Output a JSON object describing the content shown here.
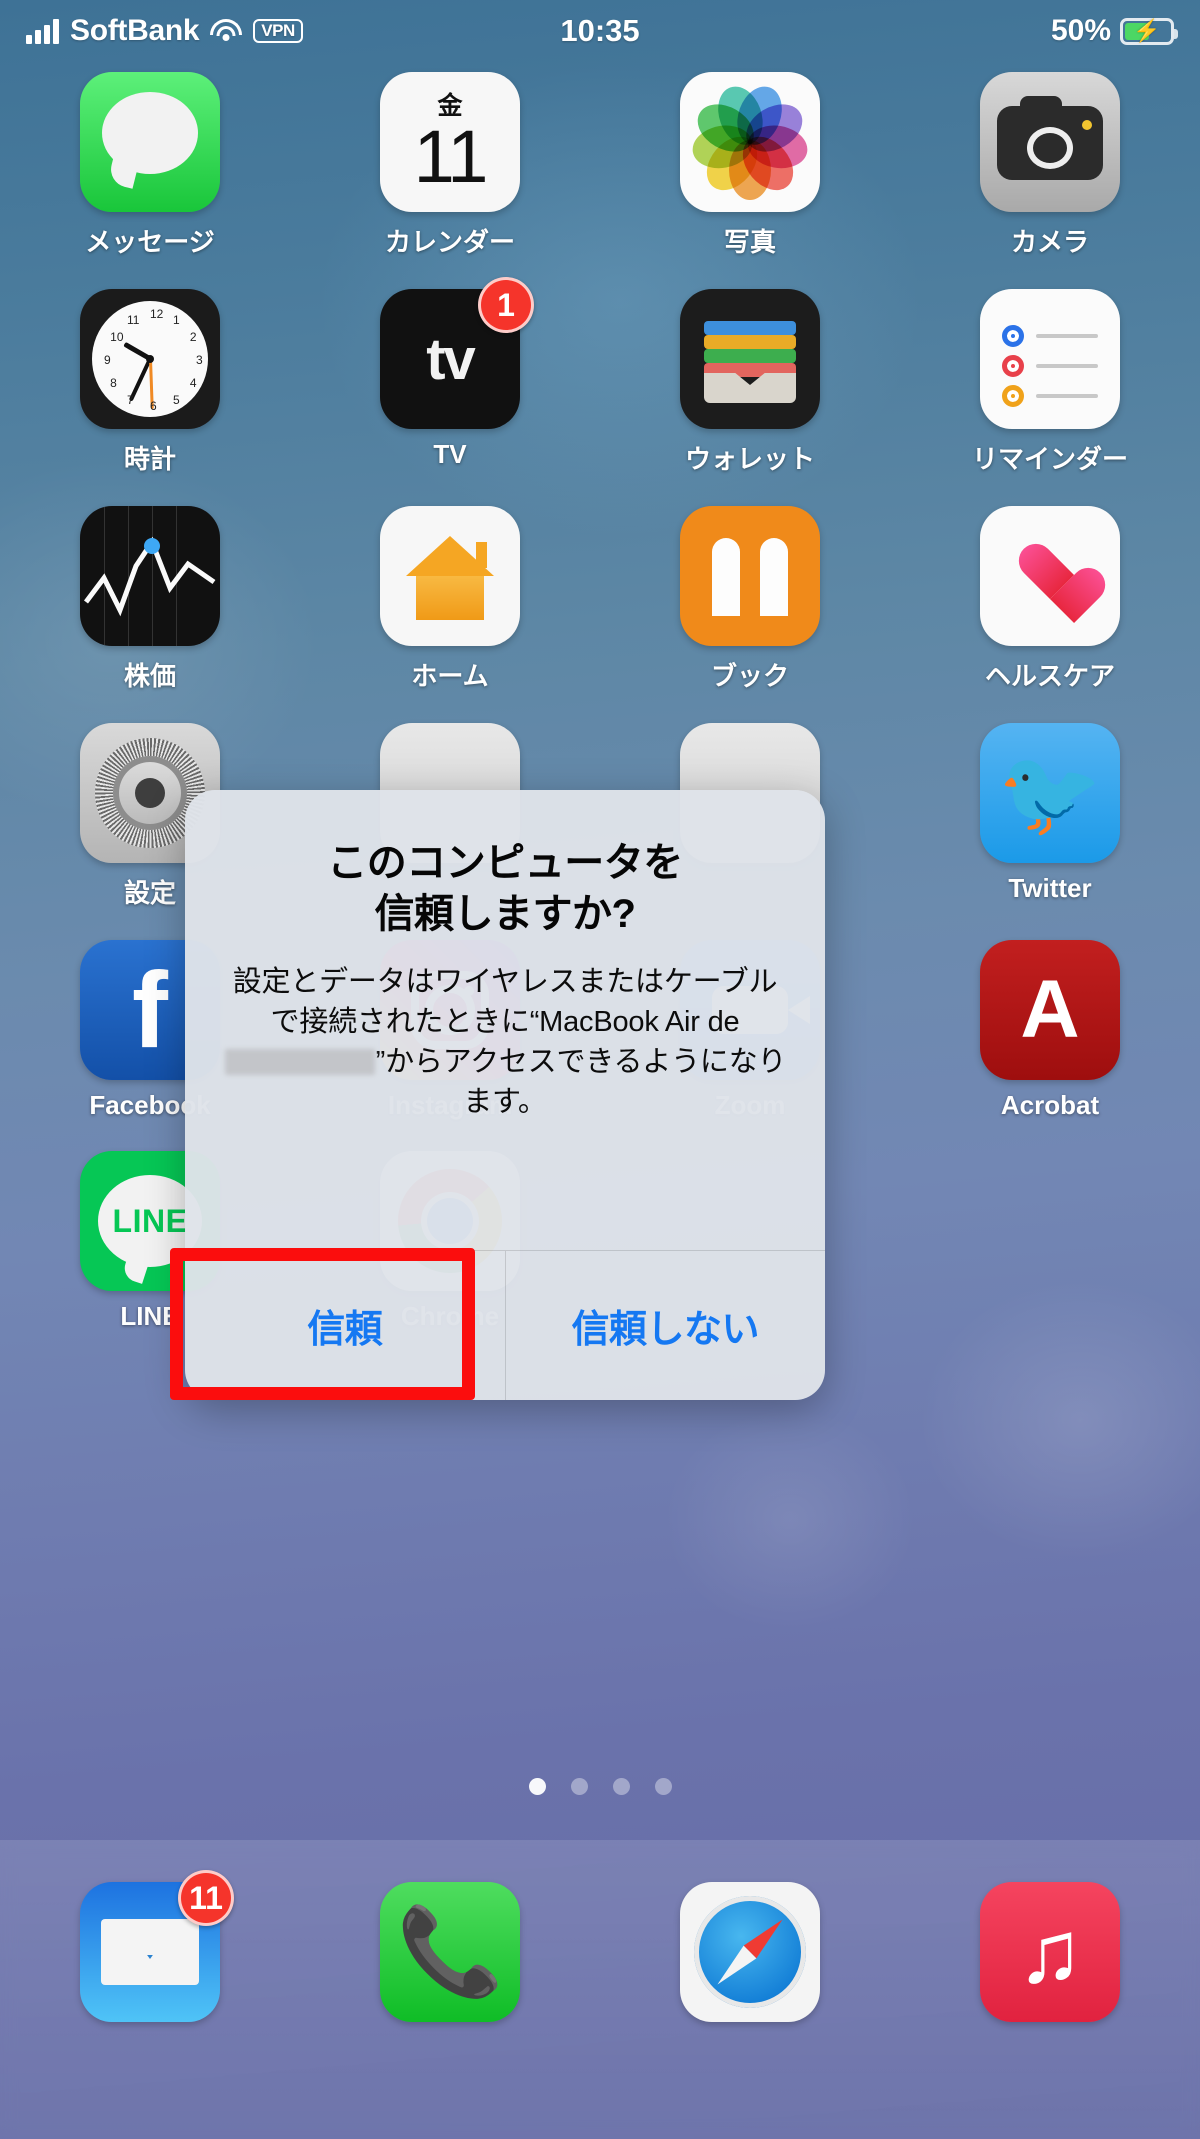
{
  "status_bar": {
    "carrier": "SoftBank",
    "signal_icon": "signal-bars-icon",
    "wifi_icon": "wifi-icon",
    "vpn_label": "VPN",
    "time": "10:35",
    "battery_percent": "50%",
    "battery_icon": "battery-charging-icon"
  },
  "home_screen": {
    "rows": [
      [
        {
          "label": "メッセージ",
          "icon": "messages-icon",
          "badge": null
        },
        {
          "label": "カレンダー",
          "icon": "calendar-icon",
          "badge": null,
          "day_of_week": "金",
          "day_number": "11"
        },
        {
          "label": "写真",
          "icon": "photos-icon",
          "badge": null
        },
        {
          "label": "カメラ",
          "icon": "camera-icon",
          "badge": null
        }
      ],
      [
        {
          "label": "時計",
          "icon": "clock-icon",
          "badge": null
        },
        {
          "label": "TV",
          "icon": "apple-tv-icon",
          "badge": "1"
        },
        {
          "label": "ウォレット",
          "icon": "wallet-icon",
          "badge": null
        },
        {
          "label": "リマインダー",
          "icon": "reminders-icon",
          "badge": null
        }
      ],
      [
        {
          "label": "株価",
          "icon": "stocks-icon",
          "badge": null
        },
        {
          "label": "ホーム",
          "icon": "home-app-icon",
          "badge": null
        },
        {
          "label": "ブック",
          "icon": "books-icon",
          "badge": null
        },
        {
          "label": "ヘルスケア",
          "icon": "health-icon",
          "badge": null
        }
      ],
      [
        {
          "label": "設定",
          "icon": "settings-gear-icon",
          "badge": null
        },
        {
          "label": "",
          "icon": "blank-icon",
          "badge": null
        },
        {
          "label": "",
          "icon": "blank-icon",
          "badge": null
        },
        {
          "label": "Twitter",
          "icon": "twitter-icon",
          "badge": null
        }
      ],
      [
        {
          "label": "Facebook",
          "icon": "facebook-icon",
          "badge": null
        },
        {
          "label": "Instagram",
          "icon": "instagram-icon",
          "badge": null
        },
        {
          "label": "Zoom",
          "icon": "zoom-icon",
          "badge": null
        },
        {
          "label": "Acrobat",
          "icon": "acrobat-icon",
          "badge": null
        }
      ],
      [
        {
          "label": "LINE",
          "icon": "line-icon",
          "badge": null,
          "mark": "LINE"
        },
        {
          "label": "Chrome",
          "icon": "chrome-icon",
          "badge": null
        },
        {
          "label": "",
          "icon": "blank-icon",
          "badge": null
        },
        {
          "label": "",
          "icon": "blank-icon",
          "badge": null
        }
      ]
    ],
    "page_dots": {
      "count": 4,
      "active_index": 0
    }
  },
  "dock": [
    {
      "label": "",
      "icon": "mail-icon",
      "badge": "11"
    },
    {
      "label": "",
      "icon": "phone-icon",
      "badge": null
    },
    {
      "label": "",
      "icon": "safari-icon",
      "badge": null
    },
    {
      "label": "",
      "icon": "music-icon",
      "badge": null
    }
  ],
  "dialog": {
    "title": "このコンピュータを\n信頼しますか?",
    "message_part1": "設定とデータはワイヤレスまたはケーブルで接続されたときに“MacBook Air de ",
    "message_part2": "”からアクセスできるようになります。",
    "trust_button": "信頼",
    "dont_trust_button": "信頼しない"
  },
  "annotation": {
    "highlight_color": "#fb0d0d",
    "highlight_target": "信頼"
  }
}
